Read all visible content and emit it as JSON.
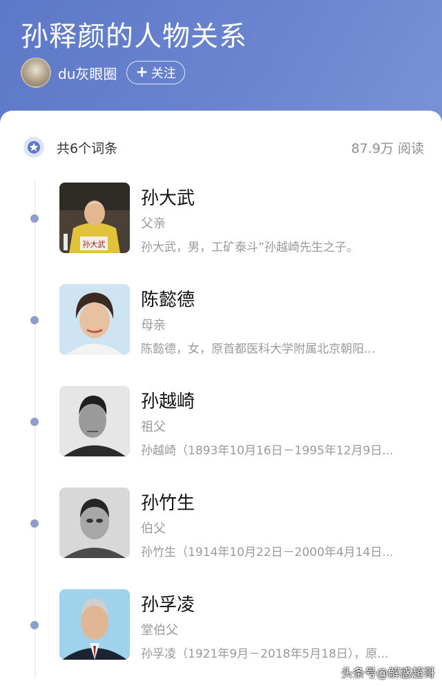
{
  "header": {
    "title": "孙释颜的人物关系",
    "author": "du灰眼圈",
    "follow_plus": "+",
    "follow_label": "关注"
  },
  "summary": {
    "count_text": "共6个词条",
    "views": "87.9万 阅读"
  },
  "people": [
    {
      "name": "孙大武",
      "relation": "父亲",
      "desc": "孙大武，男，工矿泰斗”孙越崎先生之子。",
      "photo_caption": "孙大武"
    },
    {
      "name": "陈懿德",
      "relation": "母亲",
      "desc": "陈懿德，女，原首都医科大学附属北京朝阳..."
    },
    {
      "name": "孙越崎",
      "relation": "祖父",
      "desc": "孙越崎（1893年10月16日－1995年12月9日..."
    },
    {
      "name": "孙竹生",
      "relation": "伯父",
      "desc": "孙竹生（1914年10月22日－2000年4月14日..."
    },
    {
      "name": "孙孚凌",
      "relation": "堂伯父",
      "desc": "孙孚凌（1921年9月－2018年5月18日），原..."
    }
  ],
  "watermark": "头条号@解惑超哥",
  "colors": {
    "header_bg": "#6a84cf",
    "dot": "#8f9dcc",
    "muted_text": "#9a9a9a"
  }
}
